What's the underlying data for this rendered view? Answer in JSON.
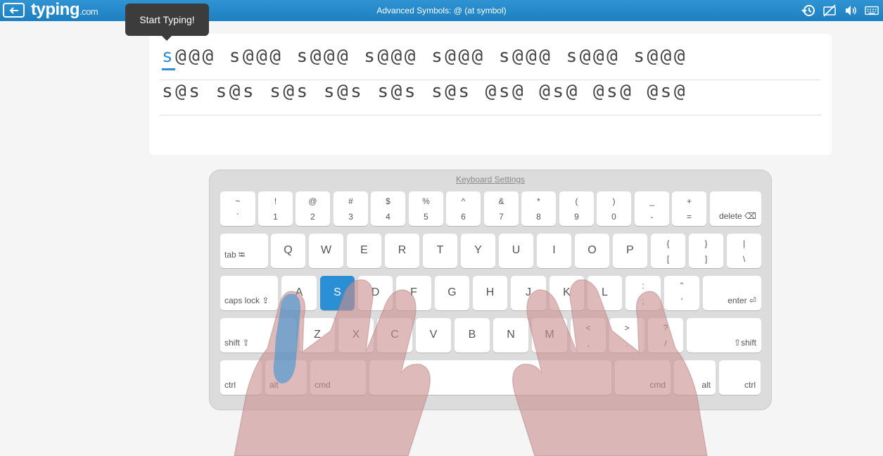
{
  "header": {
    "logo": "typing",
    "logo_domain": ".com",
    "title": "Advanced Symbols: @ (at symbol)",
    "icons": [
      "history-icon",
      "hide-hands-icon",
      "sound-icon",
      "keyboard-icon"
    ]
  },
  "tooltip": {
    "text": "Start Typing!"
  },
  "lesson": {
    "current_char": "s",
    "line1_rest": "@@@ s@@@ s@@@ s@@@ s@@@ s@@@ s@@@ s@@@",
    "line2": "s@s s@s s@s s@s s@s s@s @s@ @s@ @s@ @s@"
  },
  "keyboard": {
    "settings_label": "Keyboard Settings",
    "row1": [
      {
        "top": "~",
        "bot": "`"
      },
      {
        "top": "!",
        "bot": "1"
      },
      {
        "top": "@",
        "bot": "2"
      },
      {
        "top": "#",
        "bot": "3"
      },
      {
        "top": "$",
        "bot": "4"
      },
      {
        "top": "%",
        "bot": "5"
      },
      {
        "top": "^",
        "bot": "6"
      },
      {
        "top": "&",
        "bot": "7"
      },
      {
        "top": "*",
        "bot": "8"
      },
      {
        "top": "(",
        "bot": "9"
      },
      {
        "top": ")",
        "bot": "0"
      },
      {
        "top": "_",
        "bot": "-"
      },
      {
        "top": "+",
        "bot": "="
      }
    ],
    "delete_label": "delete ⌫",
    "tab_label": "tab ⭾",
    "row2": [
      "Q",
      "W",
      "E",
      "R",
      "T",
      "Y",
      "U",
      "I",
      "O",
      "P"
    ],
    "row2_sym": [
      {
        "top": "{",
        "bot": "["
      },
      {
        "top": "}",
        "bot": "]"
      },
      {
        "top": "|",
        "bot": "\\"
      }
    ],
    "caps_label": "caps lock ⇪",
    "row3": [
      "A",
      "S",
      "D",
      "F",
      "G",
      "H",
      "J",
      "K",
      "L"
    ],
    "row3_sym": [
      {
        "top": ":",
        "bot": ";"
      },
      {
        "top": "\"",
        "bot": "'"
      }
    ],
    "enter_label": "enter ⏎",
    "shift_label_left": "shift ⇧",
    "row4": [
      "Z",
      "X",
      "C",
      "V",
      "B",
      "N",
      "M"
    ],
    "row4_sym": [
      {
        "top": "<",
        "bot": ","
      },
      {
        "top": ">",
        "bot": "."
      },
      {
        "top": "?",
        "bot": "/"
      }
    ],
    "shift_label_right": "⇧shift",
    "ctrl_label": "ctrl",
    "alt_label": "alt",
    "cmd_label": "cmd",
    "active_key": "S"
  }
}
